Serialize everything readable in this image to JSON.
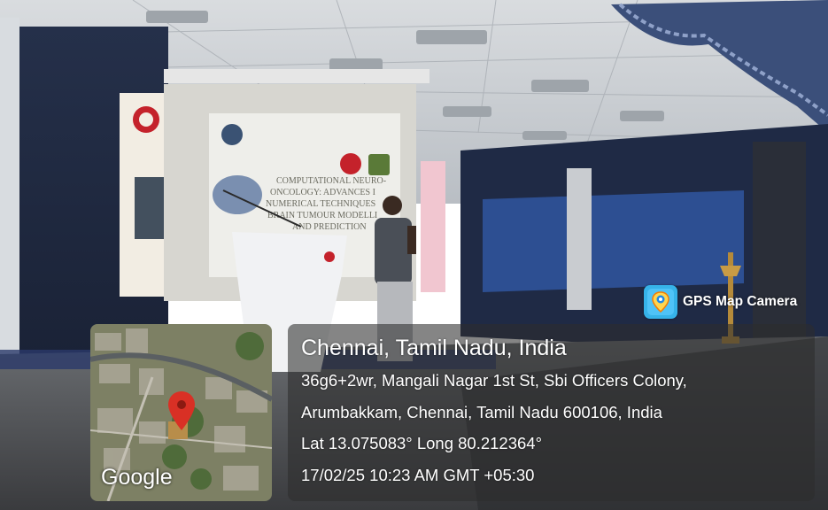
{
  "badge": {
    "label": "GPS Map Camera",
    "icon": "map-pin-camera-icon",
    "color": "#36b3e9"
  },
  "location": {
    "title": "Chennai, Tamil Nadu, India",
    "address_line1": "36g6+2wr, Mangali Nagar 1st St, Sbi Officers Colony,",
    "address_line2": "Arumbakkam, Chennai, Tamil Nadu 600106, India",
    "coordinates": "Lat 13.075083° Long 80.212364°",
    "timestamp": "17/02/25 10:23 AM GMT +05:30"
  },
  "map": {
    "logo": "Google",
    "pin_color": "#d93025"
  },
  "slide": {
    "title_lines": [
      "COMPUTATIONAL NEURO-",
      "ONCOLOGY: ADVANCES I",
      "NUMERICAL TECHNIQUES",
      "BRAIN TUMOUR MODELLI",
      "AND PREDICTION"
    ]
  }
}
